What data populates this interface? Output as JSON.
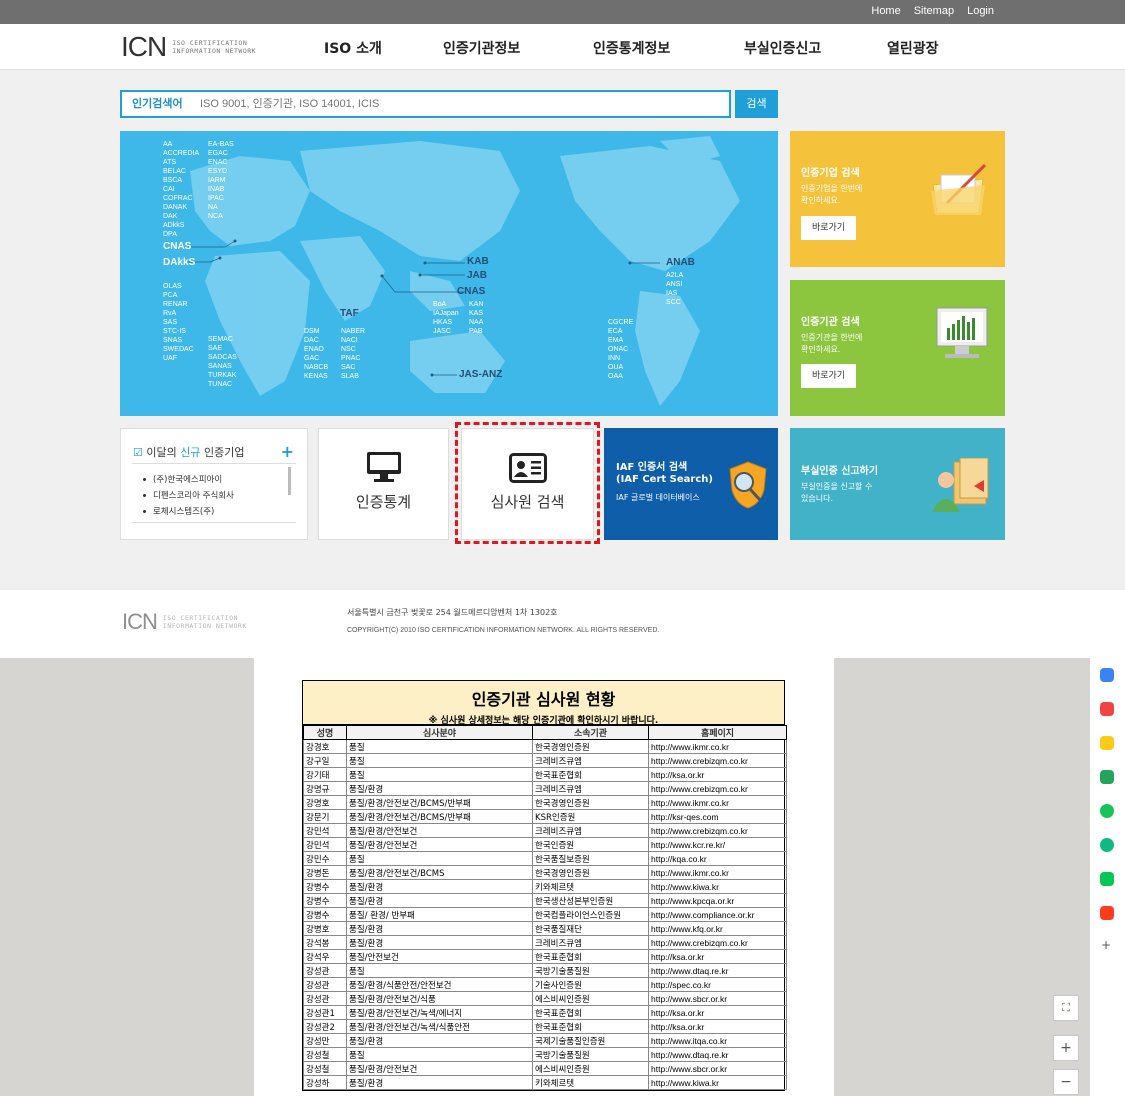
{
  "topbar": {
    "links": [
      "Home",
      "Sitemap",
      "Login"
    ]
  },
  "logo": {
    "mark": "ICN",
    "sub_line1": "ISO CERTIFICATION",
    "sub_line2": "INFORMATION NETWORK"
  },
  "nav": [
    "ISO 소개",
    "인증기관정보",
    "인증통계정보",
    "부실인증신고",
    "열린광장"
  ],
  "search": {
    "label": "인기검색어",
    "placeholder": "ISO 9001, 인증기관, ISO 14001, ICIS",
    "button": "검색"
  },
  "map_labels": {
    "col1": "AA\nACCREDIA\nATS\nBELAC\nBSCA\nCAI\nCOFRAC\nDANAK\nDAK\nADkkS\nDPA",
    "col2": "EA-BAS\nEGAC\nENAC\nESYD\nIARM\nINAB\nIPAC\nNA\nNCA",
    "cnas_eu": "CNAS",
    "dakks": "DAkkS",
    "africa1": "OLAS\nPCA\nRENAR\nRvA\nSAS\nSTC-IS\nSNAS\nSWEDAC\nUAF",
    "africa2": "SEMAC\nSAE\nSADCAS\nSANAS\nTURKAK\nTUNAC",
    "mideast1": "DSM\nDAC\nENAO\nGAC\nNABCB\nKENAS",
    "taf": "TAF",
    "mideast2": "NABER\nNACI\nNSC\nPNAC\nSAC\nSLAB",
    "asia1": "BoA\nIAJapan\nHKAS\nJASC",
    "asia2": "KAN\nKAS\nNAA\nPAB",
    "kab": "KAB",
    "jab": "JAB",
    "cnas_asia": "CNAS",
    "jasanz": "JAS-ANZ",
    "anab": "ANAB",
    "americas1": "A2LA\nANSI\nIAS\nSCC",
    "americas2": "CGCRE\nECA\nEMA\nONAC\nINN\nOUA\nOAA"
  },
  "cards": {
    "company": {
      "title": "인증기업 검색",
      "desc_line1": "인증기업을 한번에",
      "desc_line2": "확인하세요.",
      "button": "바로가기",
      "color": "#f5c23c"
    },
    "agency": {
      "title": "인증기관 검색",
      "desc_line1": "인증기관을 한번에",
      "desc_line2": "확인하세요.",
      "button": "바로가기",
      "color": "#8cc63f"
    }
  },
  "new_companies": {
    "title_pre": "이달의 ",
    "title_hl": "신규",
    "title_post": " 인증기업",
    "items": [
      "(주)한국에스피아이",
      "디펜스코리아 주식회사",
      "로체시스템즈(주)"
    ]
  },
  "tiles": {
    "stats": "인증통계",
    "auditor": "심사원 검색"
  },
  "iaf": {
    "title_line1": "IAF 인증서 검색",
    "title_line2": "(IAF Cert Search)",
    "sub": "IAF 글로벌 데이터베이스"
  },
  "report": {
    "title": "부실인증 신고하기",
    "desc_line1": "부실인증을 신고할 수",
    "desc_line2": "있습니다."
  },
  "footer": {
    "address": "서울특별시 금천구 벚꽃로 254 월드메르디앙벤처 1차 1302호",
    "copyright": "COPYRIGHT(C) 2010 ISO CERTIFICATION INFORMATION NETWORK. ALL RIGHTS RESERVED."
  },
  "sheet": {
    "title": "인증기관 심사원 현황",
    "notice": "※ 심사원 상세정보는 해당 인증기관에 확인하시기 바랍니다.",
    "columns": [
      "성명",
      "심사분야",
      "소속기관",
      "홈페이지"
    ],
    "rows": [
      [
        "강경호",
        "품질",
        "한국경영인증원",
        "http://www.ikmr.co.kr"
      ],
      [
        "강구일",
        "품질",
        "크레비즈큐엠",
        "http://www.crebizqm.co.kr"
      ],
      [
        "강기태",
        "품질",
        "한국표준협회",
        "http://ksa.or.kr"
      ],
      [
        "강명규",
        "품질/환경",
        "크레비즈큐엠",
        "http://www.crebizqm.co.kr"
      ],
      [
        "강명호",
        "품질/환경/안전보건/BCMS/반부패",
        "한국경영인증원",
        "http://www.ikmr.co.kr"
      ],
      [
        "강문기",
        "품질/환경/안전보건/BCMS/반부패",
        "KSR인증원",
        "http://ksr-qes.com"
      ],
      [
        "강민석",
        "품질/환경/안전보건",
        "크레비즈큐엠",
        "http://www.crebizqm.co.kr"
      ],
      [
        "강민석",
        "품질/환경/안전보건",
        "한국인증원",
        "http://www.kcr.re.kr/"
      ],
      [
        "강민수",
        "품질",
        "한국품질보증원",
        "http://kqa.co.kr"
      ],
      [
        "강병돈",
        "품질/환경/안전보건/BCMS",
        "한국경영인증원",
        "http://www.ikmr.co.kr"
      ],
      [
        "강병수",
        "품질/환경",
        "키와체르텟",
        "http://www.kiwa.kr"
      ],
      [
        "강병수",
        "품질/환경",
        "한국생산성본부인증원",
        "http://www.kpcqa.or.kr"
      ],
      [
        "강병수",
        "품질/ 환경/ 반부패",
        "한국컴플라이언스인증원",
        "http://www.compliance.or.kr"
      ],
      [
        "강병호",
        "품질/환경",
        "한국품질재단",
        "http://www.kfq.or.kr"
      ],
      [
        "강석봉",
        "품질/환경",
        "크레비즈큐엠",
        "http://www.crebizqm.co.kr"
      ],
      [
        "강석우",
        "품질/안전보건",
        "한국표준협회",
        "http://ksa.or.kr"
      ],
      [
        "강성관",
        "품질",
        "국방기술품질원",
        "http://www.dtaq.re.kr"
      ],
      [
        "강성관",
        "품질/환경/식품안전/안전보건",
        "기술사인증원",
        "http://spec.co.kr"
      ],
      [
        "강성관",
        "품질/환경/안전보건/식품",
        "에스비씨인증원",
        "http://www.sbcr.or.kr"
      ],
      [
        "강성관1",
        "품질/환경/안전보건/녹색/에너지",
        "한국표준협회",
        "http://ksa.or.kr"
      ],
      [
        "강성관2",
        "품질/환경/안전보건/녹색/식품안전",
        "한국표준협회",
        "http://ksa.or.kr"
      ],
      [
        "강성만",
        "품질/환경",
        "국제기술품질인증원",
        "http://www.itqa.co.kr"
      ],
      [
        "강성철",
        "품질",
        "국방기술품질원",
        "http://www.dtaq.re.kr"
      ],
      [
        "강성철",
        "품질/환경/안전보건",
        "에스비씨인증원",
        "http://www.sbcr.or.kr"
      ],
      [
        "강성하",
        "품질/환경",
        "키와체르텟",
        "http://www.kiwa.kr"
      ]
    ]
  },
  "viewer_controls": {
    "fit": "⛶",
    "zoom_in": "+",
    "zoom_out": "−"
  }
}
